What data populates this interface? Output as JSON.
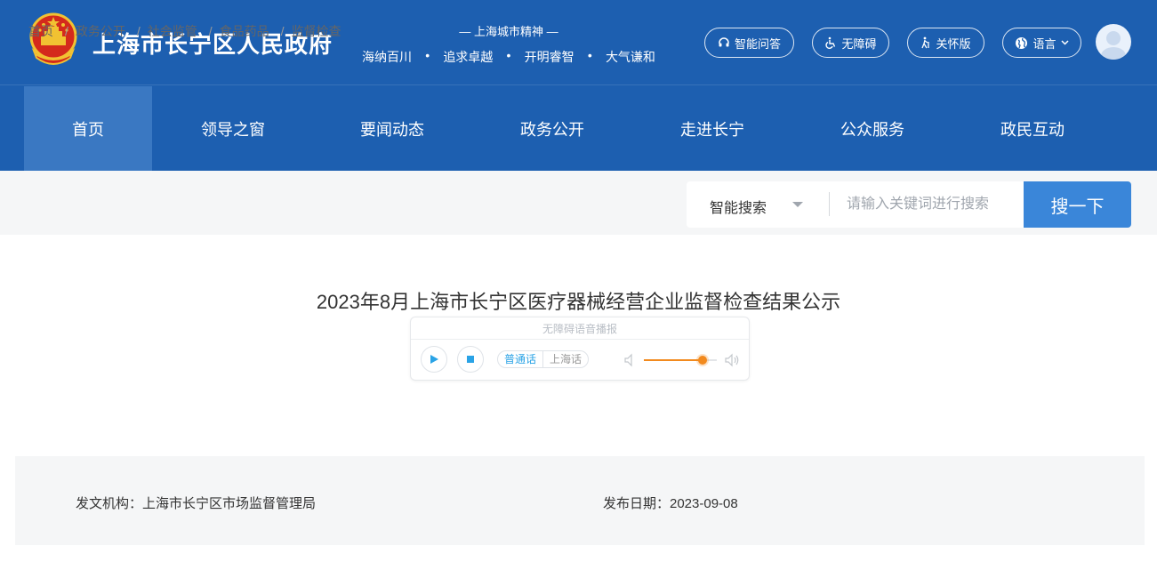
{
  "header": {
    "site_title": "上海市长宁区人民政府",
    "spirit_title": "— 上海城市精神 —",
    "spirit_words": [
      "海纳百川",
      "追求卓越",
      "开明睿智",
      "大气谦和"
    ],
    "spirit_separator": "•",
    "tools": {
      "qa": "智能问答",
      "accessibility": "无障碍",
      "care": "关怀版",
      "language": "语言"
    },
    "colors": {
      "bar": "#1d5fb0",
      "active_nav": "#3a78c2"
    }
  },
  "nav": {
    "items": [
      "首页",
      "领导之窗",
      "要闻动态",
      "政务公开",
      "走进长宁",
      "公众服务",
      "政民互动"
    ],
    "active_index": 0
  },
  "breadcrumb": {
    "items": [
      "首页",
      "政务公开",
      "社会监管",
      "食品药品",
      "监督检查"
    ],
    "separator": "/"
  },
  "search": {
    "type_label": "智能搜索",
    "placeholder": "请输入关键词进行搜索",
    "button_label": "搜一下",
    "button_color": "#3a86d9"
  },
  "article": {
    "title": "2023年8月上海市长宁区医疗器械经营企业监督检查结果公示",
    "player": {
      "label": "无障碍语音播报",
      "dialect_on": "普通话",
      "dialect_off": "上海话",
      "volume": 0.8,
      "accent": "#f28a1e"
    },
    "meta": {
      "publisher": "发文机构：上海市长宁区市场监督管理局",
      "date": "发布日期：2023-09-08"
    }
  }
}
